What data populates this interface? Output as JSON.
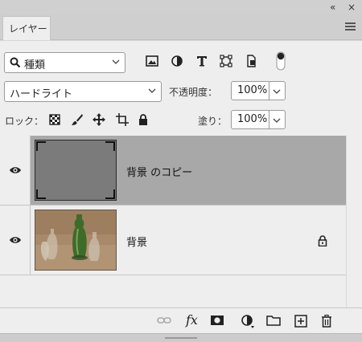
{
  "window": {
    "collapse_icon": "double-chevron-left-icon",
    "close_icon": "close-icon"
  },
  "panel": {
    "tab_label": "レイヤー",
    "menu_icon": "hamburger-icon"
  },
  "filter": {
    "kind_label": "種類",
    "filter_icons": [
      "image-filter-icon",
      "adjustment-filter-icon",
      "type-filter-icon",
      "shape-filter-icon",
      "smart-object-filter-icon"
    ]
  },
  "blend": {
    "mode": "ハードライト",
    "opacity_label": "不透明度：",
    "opacity_value": "100%"
  },
  "lock": {
    "label": "ロック：",
    "fill_label": "塗り：",
    "fill_value": "100%"
  },
  "layers": [
    {
      "name": "背景 のコピー",
      "visible": true,
      "selected": true,
      "locked": false
    },
    {
      "name": "背景",
      "visible": true,
      "selected": false,
      "locked": true
    }
  ],
  "footer": {
    "icons": [
      "link-layers-icon",
      "fx-icon",
      "layer-mask-icon",
      "adjustment-layer-icon",
      "group-folder-icon",
      "new-layer-icon",
      "trash-icon"
    ],
    "fx_label": "fx"
  },
  "colors": {
    "panel_bg": "#eeeeee",
    "selected_row": "#a8a8a8",
    "tab_bar": "#cfcfcf"
  }
}
